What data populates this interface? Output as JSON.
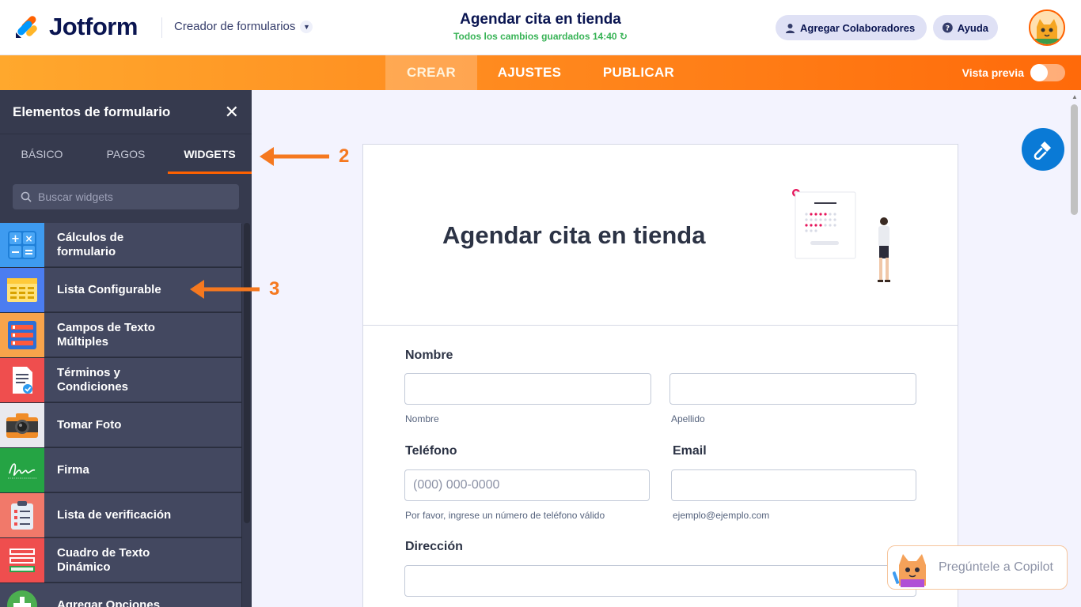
{
  "header": {
    "brand": "Jotform",
    "builder_menu": "Creador de formularios",
    "form_title": "Agendar cita en tienda",
    "save_status": "Todos los cambios guardados 14:40",
    "collaborators_button": "Agregar Colaboradores",
    "help_button": "Ayuda"
  },
  "nav": {
    "tabs": [
      "CREAR",
      "AJUSTES",
      "PUBLICAR"
    ],
    "active_tab": "CREAR",
    "preview_label": "Vista previa",
    "preview_enabled": false
  },
  "panel": {
    "title": "Elementos de formulario",
    "tabs": [
      "BÁSICO",
      "PAGOS",
      "WIDGETS"
    ],
    "active_tab": "WIDGETS",
    "search_placeholder": "Buscar widgets",
    "widgets": [
      {
        "label": "Cálculos de formulario",
        "icon": "calculator-icon"
      },
      {
        "label": "Lista Configurable",
        "icon": "table-grid-icon"
      },
      {
        "label": "Campos de Texto Múltiples",
        "icon": "multi-text-fields-icon"
      },
      {
        "label": "Términos y Condiciones",
        "icon": "document-check-icon"
      },
      {
        "label": "Tomar Foto",
        "icon": "camera-icon"
      },
      {
        "label": "Firma",
        "icon": "signature-icon"
      },
      {
        "label": "Lista de verificación",
        "icon": "checklist-clipboard-icon"
      },
      {
        "label": "Cuadro de Texto Dinámico",
        "icon": "dynamic-textbox-icon"
      },
      {
        "label": "Agregar Opciones",
        "icon": "plus-circle-icon"
      }
    ]
  },
  "annotations": {
    "arrow_widgets_tab": "2",
    "arrow_configurable_list": "3"
  },
  "form": {
    "heading": "Agendar cita en tienda",
    "name_label": "Nombre",
    "first_name_sublabel": "Nombre",
    "last_name_sublabel": "Apellido",
    "phone_label": "Teléfono",
    "phone_placeholder": "(000) 000-0000",
    "phone_sublabel": "Por favor, ingrese un número de teléfono válido",
    "email_label": "Email",
    "email_sublabel": "ejemplo@ejemplo.com",
    "address_label": "Dirección"
  },
  "copilot": {
    "label": "Pregúntele a Copilot"
  },
  "colors": {
    "brand_orange": "#ff6100",
    "panel_dark": "#292d3c",
    "accent_blue": "#0a7ad6",
    "saved_green": "#38b356"
  }
}
